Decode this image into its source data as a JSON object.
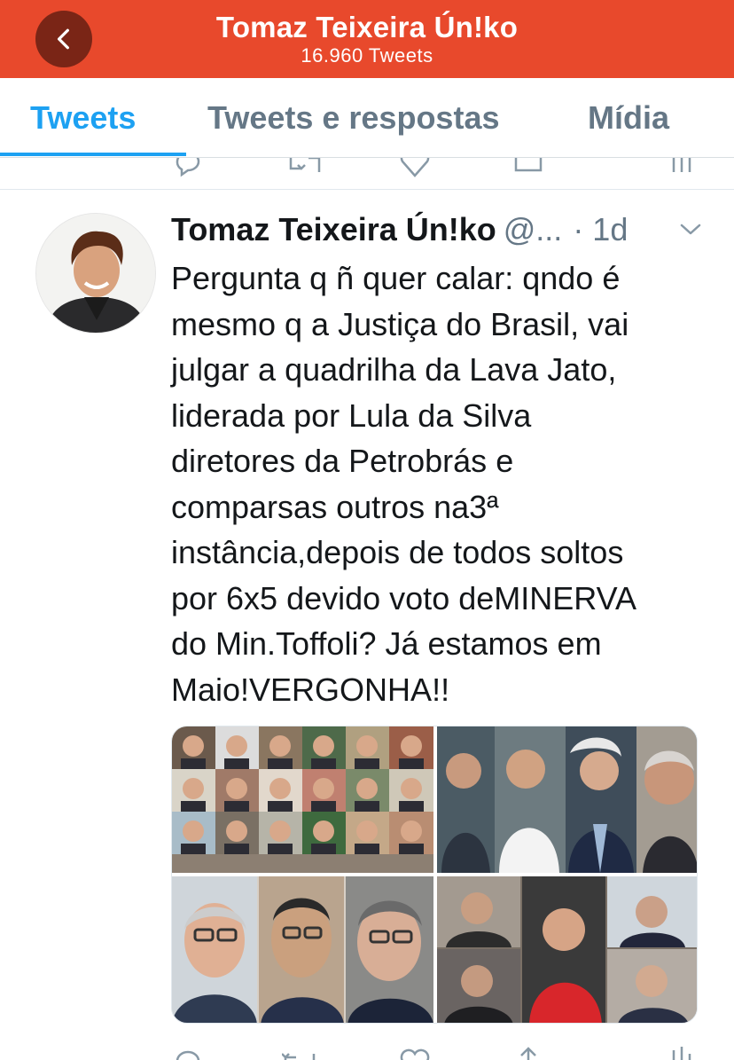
{
  "header": {
    "title": "Tomaz Teixeira Ún!ko",
    "subtitle": "16.960 Tweets",
    "background": "#e8492c",
    "back_icon": "chevron-left-icon"
  },
  "tabs": [
    {
      "label": "Tweets",
      "active": true
    },
    {
      "label": "Tweets e respostas",
      "active": false
    },
    {
      "label": "Mídia",
      "active": false
    }
  ],
  "tweet": {
    "author_name": "Tomaz Teixeira Ún!ko",
    "handle": "@...",
    "time": "· 1d",
    "text": "Pergunta q ñ quer calar: qndo é\nmesmo q a Justiça do Brasil, vai\njulgar a quadrilha da Lava Jato,\nliderada por Lula da Silva\ndiretores da Petrobrás e\ncomparsas outros na3ª\ninstância,depois de todos soltos\npor 6x5 devido voto deMINERVA\ndo Min.Toffoli? Já estamos em\nMaio!VERGONHA!!",
    "media_count": 4,
    "actions": [
      "reply-icon",
      "retweet-icon",
      "like-icon",
      "share-icon",
      "analytics-icon"
    ]
  },
  "colors": {
    "accent": "#1da1f2",
    "muted": "#657786",
    "text": "#14171a"
  }
}
